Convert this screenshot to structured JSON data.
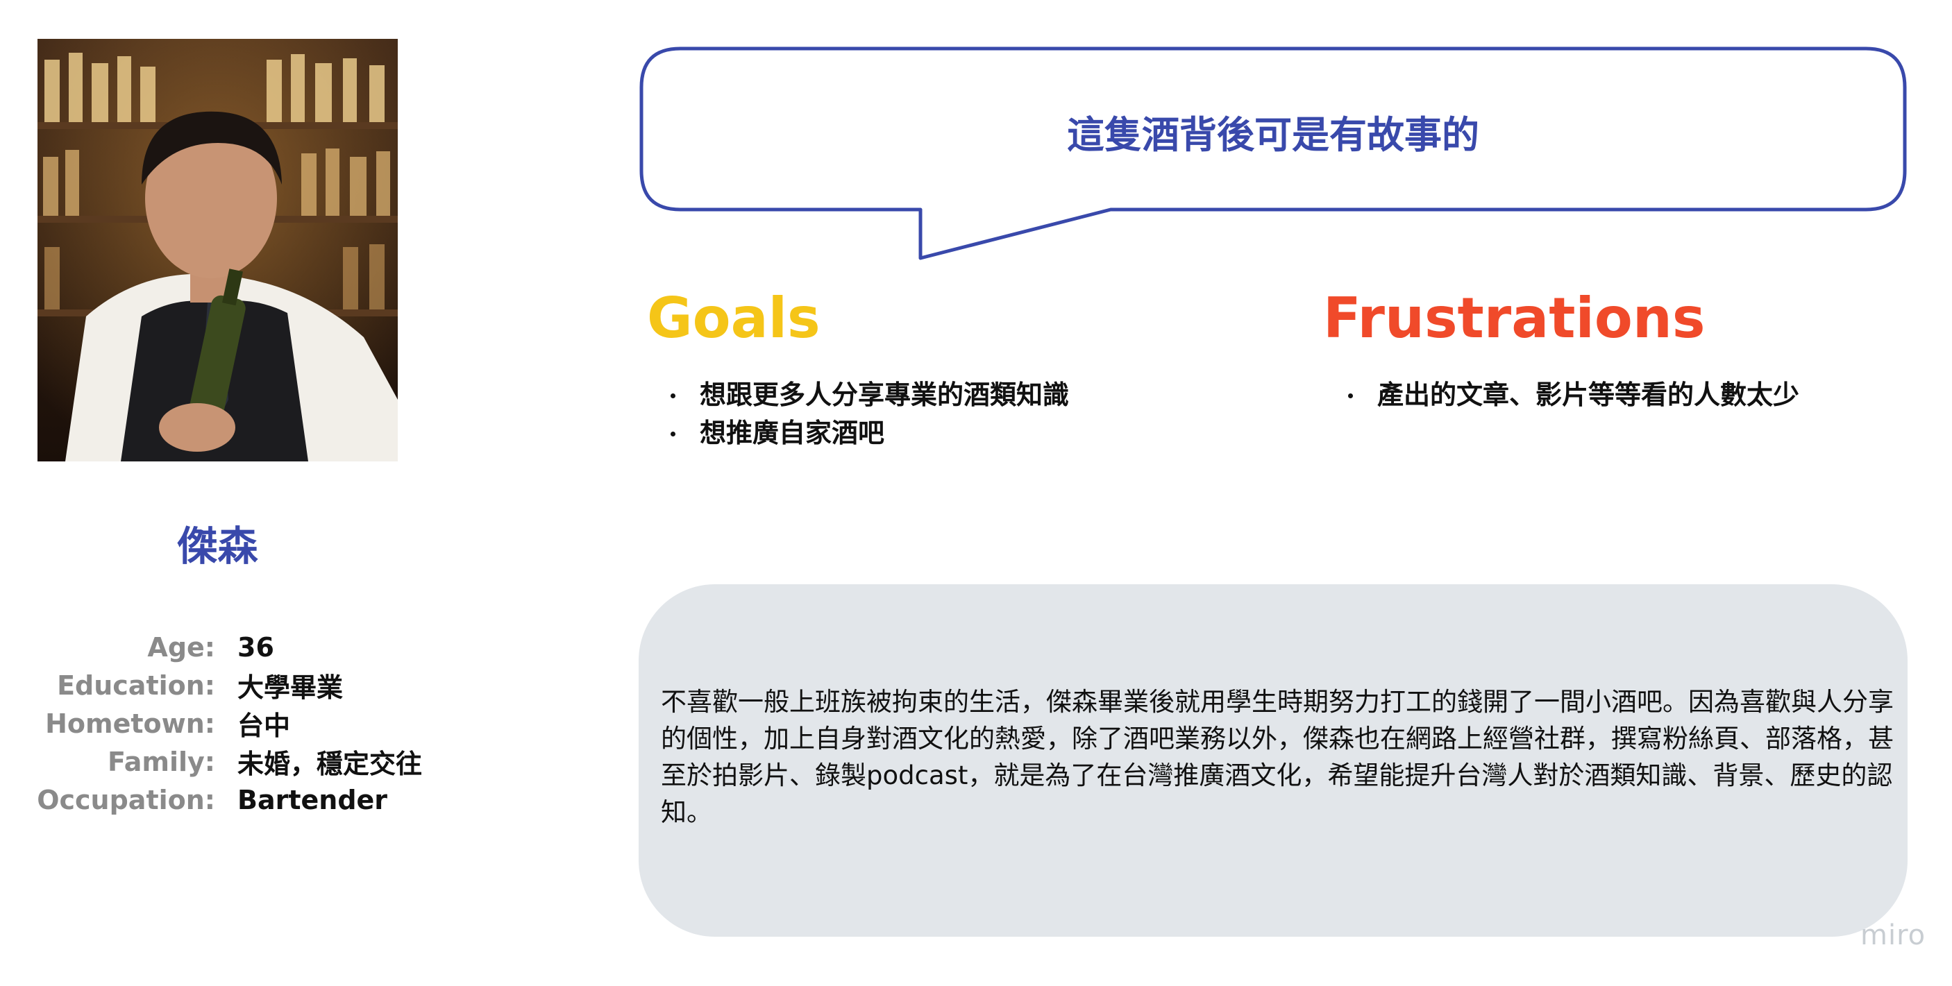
{
  "persona": {
    "name": "傑森",
    "photo_icon": "bartender-photo"
  },
  "profile": [
    {
      "label": "Age:",
      "value": "36"
    },
    {
      "label": "Education:",
      "value": "大學畢業"
    },
    {
      "label": "Hometown:",
      "value": "台中"
    },
    {
      "label": "Family:",
      "value": "未婚，穩定交往"
    },
    {
      "label": "Occupation:",
      "value": "Bartender"
    }
  ],
  "quote": "這隻酒背後可是有故事的",
  "goals": {
    "title": "Goals",
    "items": [
      "想跟更多人分享專業的酒類知識",
      "想推廣自家酒吧"
    ]
  },
  "frustrations": {
    "title": "Frustrations",
    "items": [
      "產出的文章、影片等等看的人數太少"
    ]
  },
  "bio": "不喜歡一般上班族被拘束的生活，傑森畢業後就用學生時期努力打工的錢開了一間小酒吧。因為喜歡與人分享的個性，加上自身對酒文化的熱愛，除了酒吧業務以外，傑森也在網路上經營社群，撰寫粉絲頁、部落格，甚至於拍影片、錄製podcast，就是為了在台灣推廣酒文化，希望能提升台灣人對於酒類知識、背景、歷史的認知。",
  "watermark": "miro",
  "colors": {
    "accent_blue": "#3949ab",
    "goals_yellow": "#f5c518",
    "frustrations_red": "#f04a2a",
    "bio_bg": "#e2e6ea"
  }
}
